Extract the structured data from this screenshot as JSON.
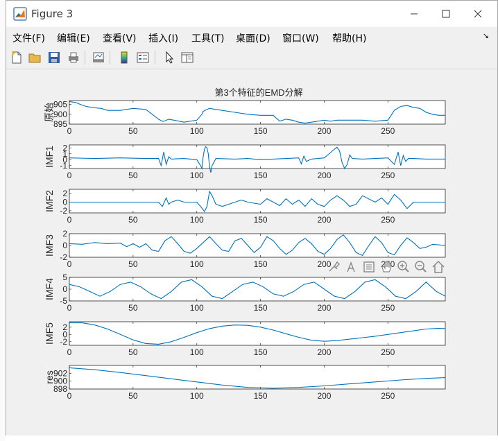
{
  "window": {
    "title": "Figure 3"
  },
  "menu": [
    {
      "label": "文件(F)"
    },
    {
      "label": "编辑(E)"
    },
    {
      "label": "查看(V)"
    },
    {
      "label": "插入(I)"
    },
    {
      "label": "工具(T)"
    },
    {
      "label": "桌面(D)"
    },
    {
      "label": "窗口(W)"
    },
    {
      "label": "帮助(H)"
    }
  ],
  "toolbar": {
    "icons": [
      "new-figure-icon",
      "open-file-icon",
      "save-icon",
      "print-icon",
      "link-plot-icon",
      "insert-colorbar-icon",
      "insert-legend-icon",
      "edit-plot-cursor-icon",
      "property-inspector-icon"
    ]
  },
  "axes_toolbar": {
    "icons": [
      "brush-icon",
      "data-tips-icon",
      "rotate-icon",
      "pan-hand-icon",
      "zoom-in-icon",
      "zoom-out-icon",
      "home-icon"
    ]
  },
  "colors": {
    "line": "#0072bd",
    "axes_bg": "#ffffff",
    "figure_bg": "#f0f0f0"
  },
  "chart_data": [
    {
      "type": "line",
      "title": "第3个特征的EMD分解",
      "ylabel": "原始",
      "xlim": [
        0,
        295
      ],
      "ylim": [
        895,
        907
      ],
      "yticks": [
        "905",
        "900",
        "895"
      ],
      "xticks": [
        "0",
        "50",
        "100",
        "150",
        "200",
        "250"
      ],
      "x": [
        0,
        5,
        8,
        12,
        15,
        20,
        25,
        30,
        40,
        50,
        60,
        70,
        73,
        74,
        78,
        82,
        90,
        100,
        104,
        105,
        108,
        110,
        115,
        120,
        130,
        140,
        150,
        160,
        165,
        170,
        175,
        180,
        185,
        190,
        200,
        205,
        210,
        215,
        220,
        225,
        230,
        240,
        250,
        255,
        260,
        265,
        270,
        275,
        280,
        285,
        290,
        295
      ],
      "values": [
        906.5,
        906,
        905.2,
        904.2,
        903.8,
        903.3,
        903,
        902,
        902,
        903,
        902.5,
        897.5,
        896.4,
        896.4,
        897.5,
        897,
        896,
        897,
        900,
        901.5,
        902.5,
        903,
        902.5,
        902,
        901,
        900,
        899.5,
        899.5,
        896.5,
        897.5,
        897,
        896,
        895.5,
        896,
        897,
        896.5,
        897,
        897,
        897,
        897,
        897,
        896.5,
        897,
        902,
        904,
        904.5,
        903.5,
        903,
        901,
        900,
        899.5,
        899.5
      ]
    },
    {
      "type": "line",
      "ylabel": "IMF1",
      "xlim": [
        0,
        295
      ],
      "ylim": [
        -1.5,
        2.5
      ],
      "yticks": [
        "2",
        "1",
        "0",
        "-1"
      ],
      "xticks": [
        "0",
        "50",
        "100",
        "150",
        "200",
        "250"
      ],
      "x": [
        0,
        20,
        40,
        60,
        70,
        72,
        74,
        76,
        78,
        80,
        90,
        100,
        103,
        104,
        105,
        106,
        107,
        108,
        109,
        110,
        111,
        112,
        115,
        130,
        140,
        150,
        160,
        170,
        180,
        182,
        184,
        186,
        190,
        200,
        205,
        208,
        210,
        212,
        214,
        216,
        218,
        220,
        222,
        230,
        240,
        250,
        255,
        258,
        260,
        262,
        264,
        266,
        270,
        280,
        295
      ],
      "values": [
        0.3,
        0.2,
        0.3,
        0.2,
        0.2,
        -1,
        1.3,
        -0.8,
        0.5,
        0.1,
        0.2,
        0,
        -1,
        -1.5,
        0.5,
        1.8,
        2.2,
        2,
        1,
        -1.2,
        -2.2,
        -1,
        0.2,
        0.1,
        0.2,
        0,
        0.1,
        0.2,
        0.3,
        -0.7,
        0.6,
        -0.3,
        0.1,
        0.3,
        1.2,
        1.8,
        2.1,
        1.5,
        -0.5,
        -1.5,
        -0.8,
        0.8,
        0.2,
        0.1,
        0.2,
        0.3,
        -0.8,
        1.3,
        -1,
        0.7,
        -0.3,
        0.2,
        0.2,
        0.1,
        0.1
      ]
    },
    {
      "type": "line",
      "ylabel": "IMF2",
      "xlim": [
        0,
        295
      ],
      "ylim": [
        -2.5,
        3
      ],
      "yticks": [
        "2",
        "0",
        "-2"
      ],
      "xticks": [
        "0",
        "50",
        "100",
        "150",
        "200",
        "250"
      ],
      "x": [
        0,
        20,
        40,
        60,
        70,
        73,
        76,
        78,
        80,
        85,
        90,
        100,
        103,
        106,
        108,
        110,
        112,
        115,
        120,
        130,
        135,
        140,
        150,
        155,
        160,
        165,
        170,
        175,
        180,
        185,
        190,
        195,
        200,
        205,
        210,
        215,
        220,
        225,
        230,
        240,
        245,
        250,
        255,
        260,
        265,
        270,
        280,
        295
      ],
      "values": [
        0,
        0,
        0,
        0,
        0,
        -1,
        1,
        -0.5,
        0,
        0.5,
        0,
        0,
        -1,
        -2.2,
        -1,
        2.5,
        1.5,
        -0.5,
        -1,
        0,
        0.5,
        0,
        -0.5,
        0.8,
        0,
        -0.8,
        0.8,
        -0.5,
        0.5,
        -1,
        0.8,
        -0.5,
        -1,
        0.5,
        1.5,
        0.5,
        -1,
        -0.5,
        1.5,
        0,
        1,
        -0.5,
        1.8,
        0.5,
        -1.5,
        0,
        0,
        0
      ]
    },
    {
      "type": "line",
      "ylabel": "IMF3",
      "xlim": [
        0,
        295
      ],
      "ylim": [
        -2,
        2
      ],
      "yticks": [
        "2",
        "0",
        "-2"
      ],
      "xticks": [
        "0",
        "50",
        "100",
        "150",
        "200",
        "250"
      ],
      "x": [
        0,
        10,
        20,
        30,
        40,
        45,
        50,
        55,
        60,
        65,
        70,
        75,
        80,
        85,
        90,
        95,
        100,
        105,
        110,
        115,
        120,
        125,
        130,
        135,
        140,
        145,
        150,
        155,
        160,
        165,
        170,
        175,
        180,
        185,
        190,
        195,
        200,
        205,
        210,
        215,
        220,
        225,
        230,
        235,
        240,
        245,
        250,
        255,
        260,
        265,
        270,
        275,
        280,
        285,
        290,
        295
      ],
      "values": [
        0.3,
        0.2,
        0.5,
        0.3,
        0.4,
        -0.2,
        0.3,
        -0.3,
        0.3,
        -0.8,
        -1,
        0.8,
        1.5,
        0.3,
        -1,
        -1.3,
        -0.5,
        0.5,
        1.5,
        0.3,
        -0.8,
        -1,
        0.8,
        1.2,
        0,
        -1.2,
        -0.3,
        1.5,
        0.8,
        -0.5,
        -1.5,
        -0.8,
        0.5,
        1.2,
        0.3,
        -1,
        -1.5,
        -0.5,
        1,
        1.8,
        0.5,
        -1.2,
        -1.7,
        0,
        1.5,
        0.5,
        -1.2,
        -1.6,
        0,
        1.3,
        0.5,
        -0.5,
        -0.3,
        0.2,
        0.1,
        0
      ]
    },
    {
      "type": "line",
      "ylabel": "IMF4",
      "xlim": [
        0,
        295
      ],
      "ylim": [
        -5,
        5
      ],
      "yticks": [
        "5",
        "0",
        "-5"
      ],
      "xticks": [
        "0",
        "50",
        "100",
        "150",
        "200",
        "250"
      ],
      "x": [
        0,
        8,
        16,
        24,
        32,
        40,
        48,
        56,
        64,
        72,
        80,
        88,
        96,
        104,
        112,
        120,
        128,
        136,
        144,
        152,
        160,
        168,
        176,
        184,
        192,
        200,
        208,
        216,
        224,
        232,
        240,
        248,
        256,
        264,
        272,
        280,
        288,
        295
      ],
      "values": [
        2,
        1,
        -1,
        -3,
        -1,
        2,
        3,
        1,
        -2,
        -4,
        -1,
        3,
        4,
        1,
        -3,
        -4,
        -1,
        2,
        3,
        1,
        -2,
        -3,
        -1,
        2,
        3,
        0,
        -3,
        -4,
        -1,
        3,
        4,
        1,
        -3,
        -4,
        -1,
        3,
        -1,
        -3
      ]
    },
    {
      "type": "line",
      "ylabel": "IMF5",
      "xlim": [
        0,
        295
      ],
      "ylim": [
        -3,
        3.5
      ],
      "yticks": [
        "2",
        "0",
        "-2"
      ],
      "xticks": [
        "0",
        "50",
        "100",
        "150",
        "200",
        "250"
      ],
      "x": [
        0,
        10,
        20,
        30,
        40,
        50,
        60,
        70,
        80,
        90,
        100,
        110,
        120,
        130,
        140,
        150,
        160,
        170,
        180,
        190,
        200,
        210,
        220,
        230,
        240,
        250,
        260,
        270,
        280,
        290,
        295
      ],
      "values": [
        3.2,
        3.2,
        2.6,
        1.5,
        0,
        -1.5,
        -2.5,
        -2.7,
        -2,
        -0.8,
        0.5,
        1.6,
        2.3,
        2.6,
        2.5,
        2,
        1.2,
        0.2,
        -0.8,
        -1.6,
        -1.9,
        -1.7,
        -1.3,
        -0.9,
        -0.5,
        0,
        0.5,
        1,
        1.5,
        1.7,
        1.6
      ]
    },
    {
      "type": "line",
      "ylabel": "res",
      "xlim": [
        0,
        295
      ],
      "ylim": [
        898,
        904
      ],
      "yticks": [
        "902",
        "900",
        "898"
      ],
      "xticks": [
        "0",
        "50",
        "100",
        "150",
        "200",
        "250"
      ],
      "x": [
        0,
        20,
        40,
        60,
        80,
        100,
        120,
        140,
        160,
        180,
        200,
        220,
        240,
        260,
        280,
        295
      ],
      "values": [
        903.4,
        902.9,
        902.2,
        901.4,
        900.6,
        899.8,
        899,
        898.4,
        898.2,
        898.4,
        898.8,
        899.3,
        899.8,
        900.3,
        900.7,
        900.9
      ]
    }
  ]
}
